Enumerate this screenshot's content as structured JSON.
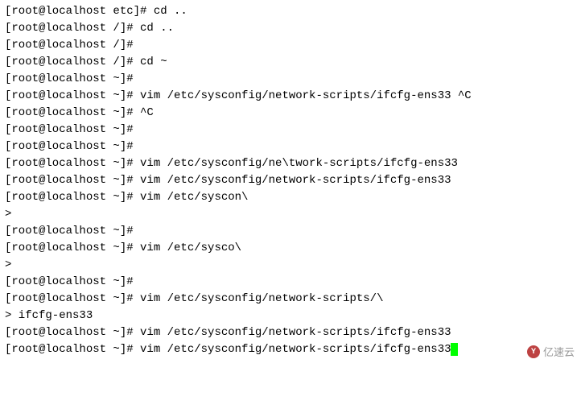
{
  "lines": {
    "l0": "[root@localhost etc]# cd ..",
    "l1": "[root@localhost /]# cd ..",
    "l2": "[root@localhost /]#",
    "l3": "[root@localhost /]# cd ~",
    "l4": "[root@localhost ~]#",
    "l5": "[root@localhost ~]# vim /etc/sysconfig/network-scripts/ifcfg-ens33 ^C",
    "l6": "[root@localhost ~]# ^C",
    "l7": "[root@localhost ~]#",
    "l8": "[root@localhost ~]#",
    "l9": "[root@localhost ~]# vim /etc/sysconfig/ne\\twork-scripts/ifcfg-ens33",
    "l10": "[root@localhost ~]# vim /etc/sysconfig/network-scripts/ifcfg-ens33",
    "l11": "[root@localhost ~]# vim /etc/syscon\\",
    "l12": ">",
    "l13": "[root@localhost ~]#",
    "l14": "[root@localhost ~]# vim /etc/sysco\\",
    "l15": ">",
    "l16": "[root@localhost ~]#",
    "l17": "[root@localhost ~]# vim /etc/sysconfig/network-scripts/\\",
    "l18": "> ifcfg-ens33",
    "l19": "[root@localhost ~]# vim /etc/sysconfig/network-scripts/ifcfg-ens33",
    "l20": "[root@localhost ~]# vim /etc/sysconfig/network-scripts/ifcfg-ens33"
  },
  "watermark": {
    "icon_text": "Y",
    "label": "亿速云"
  }
}
